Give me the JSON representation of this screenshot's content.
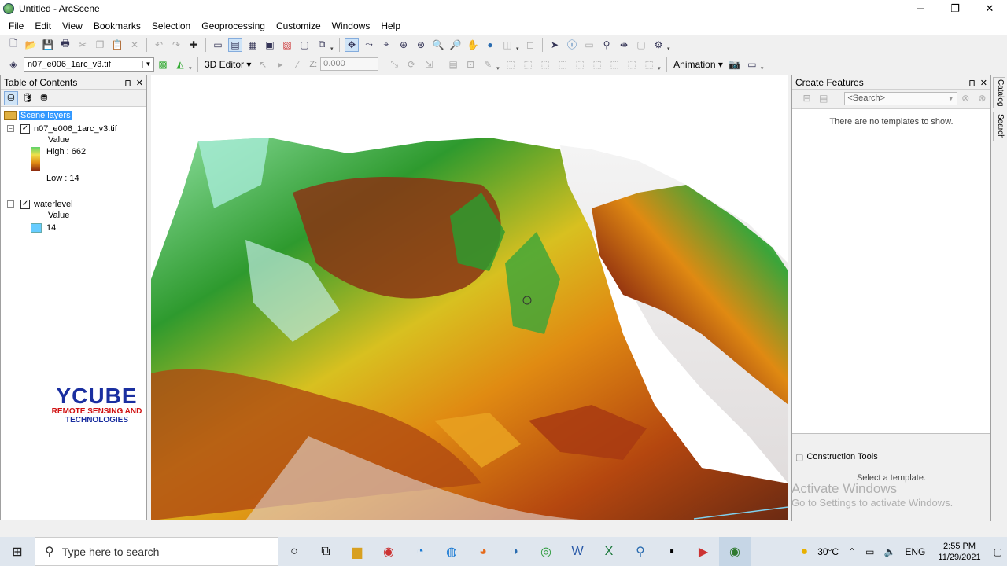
{
  "window": {
    "title": "Untitled - ArcScene",
    "minimize": "─",
    "restore": "❐",
    "close": "✕"
  },
  "menu": [
    "File",
    "Edit",
    "View",
    "Bookmarks",
    "Selection",
    "Geoprocessing",
    "Customize",
    "Windows",
    "Help"
  ],
  "toolbar2": {
    "layer_select": "n07_e006_1arc_v3.tif",
    "editor_3d": "3D Editor ▾",
    "z_label": "Z:",
    "z_value": "0.000",
    "animation": "Animation ▾"
  },
  "toc": {
    "title": "Table of Contents",
    "scene_layers": "Scene layers",
    "layers": [
      {
        "name": "n07_e006_1arc_v3.tif",
        "field": "Value",
        "high": "High : 662",
        "low": "Low : 14"
      },
      {
        "name": "waterlevel",
        "field": "Value",
        "class_value": "14",
        "swatch": "#66ccff"
      }
    ]
  },
  "watermark": {
    "name": "YCUBE",
    "line1": "REMOTE SENSING AND",
    "line2": "TECHNOLOGIES"
  },
  "create_features": {
    "title": "Create Features",
    "search_placeholder": "<Search>",
    "empty_text": "There are no templates to show.",
    "construction_tools": "Construction Tools",
    "select_template": "Select a template."
  },
  "activation": {
    "line1": "Activate Windows",
    "line2": "Go to Settings to activate Windows."
  },
  "side_tabs": [
    "Catalog",
    "Search"
  ],
  "taskbar": {
    "search_placeholder": "Type here to search",
    "weather": "30°C",
    "language": "ENG",
    "time": "2:55 PM",
    "date": "11/29/2021"
  },
  "colors": {
    "accent": "#3399ff",
    "terrain_high": "#2e9a2e",
    "terrain_mid": "#e08a12",
    "terrain_low": "#8c2a10"
  }
}
